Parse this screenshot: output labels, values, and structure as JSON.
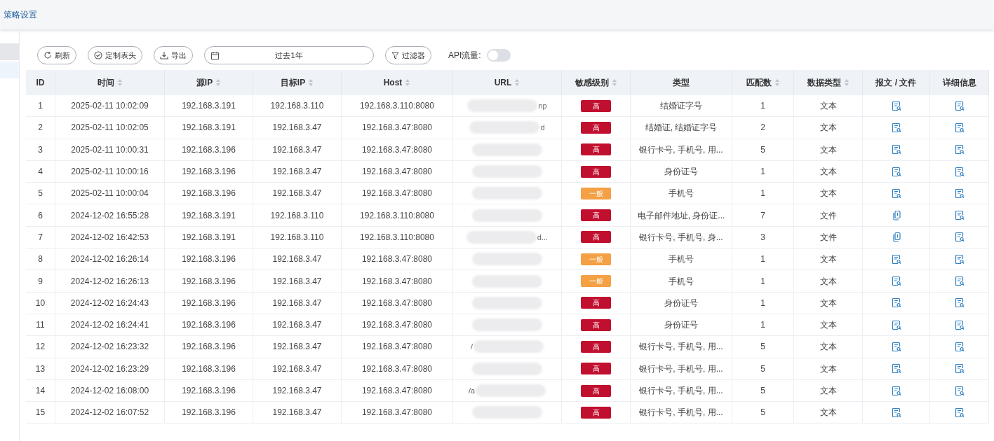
{
  "breadcrumb": "策略设置",
  "toolbar": {
    "refresh": "刷新",
    "columns": "定制表头",
    "export": "导出",
    "date_range": "过去1年",
    "filter": "过滤器",
    "api_label": "API流量:",
    "api_on": false
  },
  "table": {
    "columns": [
      {
        "label": "ID",
        "sortable": false
      },
      {
        "label": "时间",
        "sortable": true
      },
      {
        "label": "源IP",
        "sortable": true
      },
      {
        "label": "目标IP",
        "sortable": true
      },
      {
        "label": "Host",
        "sortable": true
      },
      {
        "label": "URL",
        "sortable": true
      },
      {
        "label": "敏感级别",
        "sortable": true
      },
      {
        "label": "类型",
        "sortable": false
      },
      {
        "label": "匹配数",
        "sortable": true
      },
      {
        "label": "数据类型",
        "sortable": true
      },
      {
        "label": "报文 / 文件",
        "sortable": false
      },
      {
        "label": "详细信息",
        "sortable": false
      }
    ],
    "rows": [
      {
        "id": "1",
        "time": "2025-02-11 10:02:09",
        "src": "192.168.3.191",
        "dst": "192.168.3.110",
        "host": "192.168.3.110:8080",
        "url_tail": "np",
        "sensitivity": {
          "text": "高",
          "color": "#c10f2f"
        },
        "type": "结婚证字号",
        "matches": "1",
        "data_type": "文本",
        "payload": {
          "kind": "text"
        }
      },
      {
        "id": "2",
        "time": "2025-02-11 10:02:05",
        "src": "192.168.3.191",
        "dst": "192.168.3.47",
        "host": "192.168.3.47:8080",
        "url_tail": "d",
        "sensitivity": {
          "text": "高",
          "color": "#c10f2f"
        },
        "type": "结婚证, 结婚证字号",
        "matches": "2",
        "data_type": "文本",
        "payload": {
          "kind": "text"
        }
      },
      {
        "id": "3",
        "time": "2025-02-11 10:00:31",
        "src": "192.168.3.196",
        "dst": "192.168.3.47",
        "host": "192.168.3.47:8080",
        "sensitivity": {
          "text": "高",
          "color": "#c10f2f"
        },
        "type": "银行卡号, 手机号, 用...",
        "matches": "5",
        "data_type": "文本",
        "payload": {
          "kind": "text"
        }
      },
      {
        "id": "4",
        "time": "2025-02-11 10:00:16",
        "src": "192.168.3.196",
        "dst": "192.168.3.47",
        "host": "192.168.3.47:8080",
        "sensitivity": {
          "text": "高",
          "color": "#c10f2f"
        },
        "type": "身份证号",
        "matches": "1",
        "data_type": "文本",
        "payload": {
          "kind": "text"
        }
      },
      {
        "id": "5",
        "time": "2025-02-11 10:00:04",
        "src": "192.168.3.196",
        "dst": "192.168.3.47",
        "host": "192.168.3.47:8080",
        "sensitivity": {
          "text": "一般",
          "color": "#f4a044"
        },
        "type": "手机号",
        "matches": "1",
        "data_type": "文本",
        "payload": {
          "kind": "text"
        }
      },
      {
        "id": "6",
        "time": "2024-12-02 16:55:28",
        "src": "192.168.3.191",
        "dst": "192.168.3.110",
        "host": "192.168.3.110:8080",
        "sensitivity": {
          "text": "高",
          "color": "#c10f2f"
        },
        "type": "电子邮件地址, 身份证...",
        "matches": "7",
        "data_type": "文件",
        "payload": {
          "kind": "file"
        }
      },
      {
        "id": "7",
        "time": "2024-12-02 16:42:53",
        "src": "192.168.3.191",
        "dst": "192.168.3.110",
        "host": "192.168.3.110:8080",
        "url_tail": "d...",
        "sensitivity": {
          "text": "高",
          "color": "#c10f2f"
        },
        "type": "银行卡号, 手机号, 身...",
        "matches": "3",
        "data_type": "文件",
        "payload": {
          "kind": "file"
        }
      },
      {
        "id": "8",
        "time": "2024-12-02 16:26:14",
        "src": "192.168.3.196",
        "dst": "192.168.3.47",
        "host": "192.168.3.47:8080",
        "sensitivity": {
          "text": "一般",
          "color": "#f4a044"
        },
        "type": "手机号",
        "matches": "1",
        "data_type": "文本",
        "payload": {
          "kind": "text"
        }
      },
      {
        "id": "9",
        "time": "2024-12-02 16:26:13",
        "src": "192.168.3.196",
        "dst": "192.168.3.47",
        "host": "192.168.3.47:8080",
        "sensitivity": {
          "text": "一般",
          "color": "#f4a044"
        },
        "type": "手机号",
        "matches": "1",
        "data_type": "文本",
        "payload": {
          "kind": "text"
        }
      },
      {
        "id": "10",
        "time": "2024-12-02 16:24:43",
        "src": "192.168.3.196",
        "dst": "192.168.3.47",
        "host": "192.168.3.47:8080",
        "sensitivity": {
          "text": "高",
          "color": "#c10f2f"
        },
        "type": "身份证号",
        "matches": "1",
        "data_type": "文本",
        "payload": {
          "kind": "text"
        }
      },
      {
        "id": "11",
        "time": "2024-12-02 16:24:41",
        "src": "192.168.3.196",
        "dst": "192.168.3.47",
        "host": "192.168.3.47:8080",
        "sensitivity": {
          "text": "高",
          "color": "#c10f2f"
        },
        "type": "身份证号",
        "matches": "1",
        "data_type": "文本",
        "payload": {
          "kind": "text"
        }
      },
      {
        "id": "12",
        "time": "2024-12-02 16:23:32",
        "src": "192.168.3.196",
        "dst": "192.168.3.47",
        "host": "192.168.3.47:8080",
        "url_head": "/",
        "sensitivity": {
          "text": "高",
          "color": "#c10f2f"
        },
        "type": "银行卡号, 手机号, 用...",
        "matches": "5",
        "data_type": "文本",
        "payload": {
          "kind": "text"
        }
      },
      {
        "id": "13",
        "time": "2024-12-02 16:23:29",
        "src": "192.168.3.196",
        "dst": "192.168.3.47",
        "host": "192.168.3.47:8080",
        "sensitivity": {
          "text": "高",
          "color": "#c10f2f"
        },
        "type": "银行卡号, 手机号, 用...",
        "matches": "5",
        "data_type": "文本",
        "payload": {
          "kind": "text"
        }
      },
      {
        "id": "14",
        "time": "2024-12-02 16:08:00",
        "src": "192.168.3.196",
        "dst": "192.168.3.47",
        "host": "192.168.3.47:8080",
        "url_head": "/a",
        "sensitivity": {
          "text": "高",
          "color": "#c10f2f"
        },
        "type": "银行卡号, 手机号, 用...",
        "matches": "5",
        "data_type": "文本",
        "payload": {
          "kind": "text"
        }
      },
      {
        "id": "15",
        "time": "2024-12-02 16:07:52",
        "src": "192.168.3.196",
        "dst": "192.168.3.47",
        "host": "192.168.3.47:8080",
        "sensitivity": {
          "text": "高",
          "color": "#c10f2f"
        },
        "type": "银行卡号, 手机号, 用...",
        "matches": "5",
        "data_type": "文本",
        "payload": {
          "kind": "text"
        }
      }
    ]
  }
}
